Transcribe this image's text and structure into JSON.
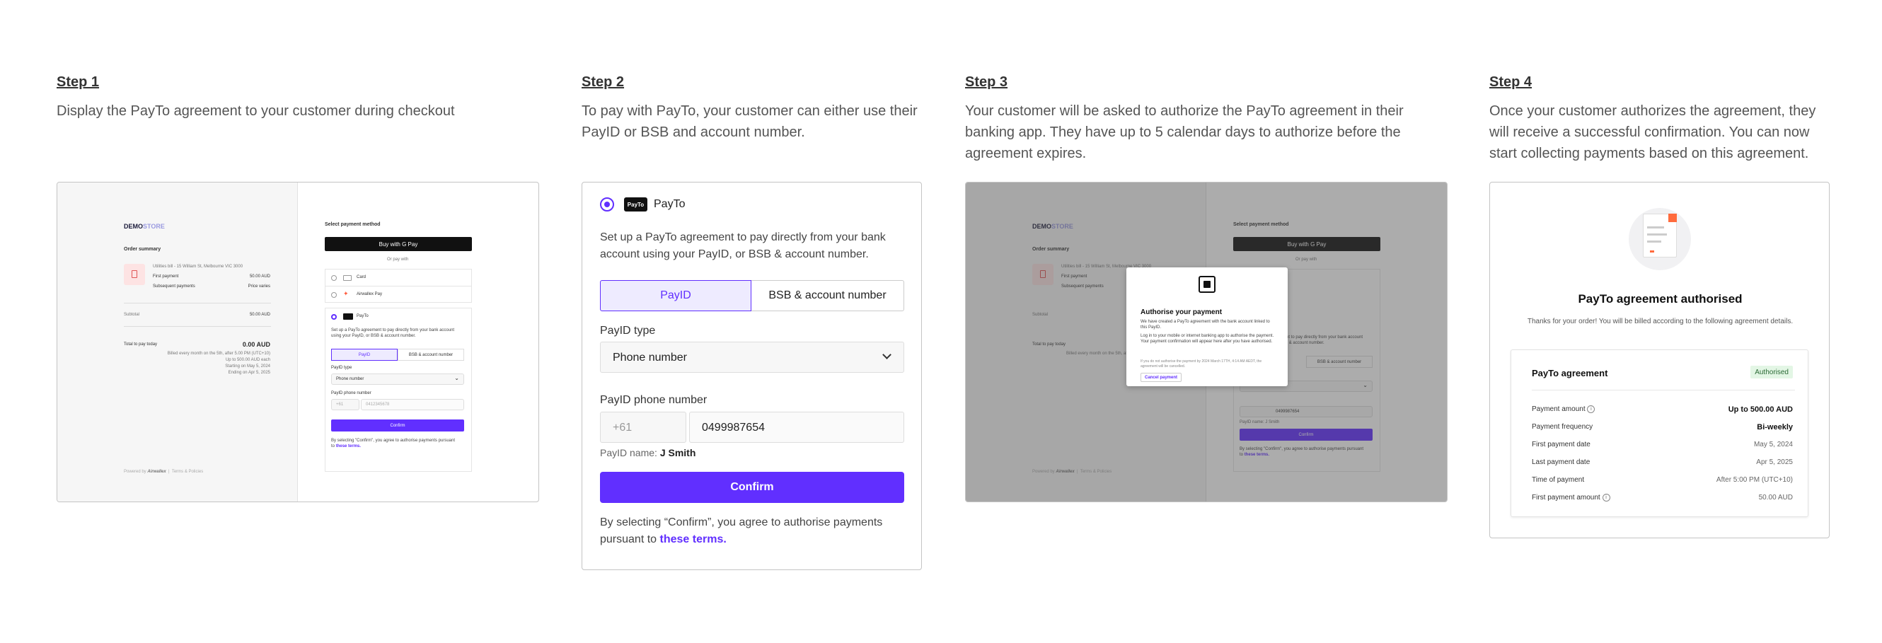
{
  "steps": [
    {
      "title": "Step 1",
      "desc": "Display the PayTo agreement to your customer during checkout"
    },
    {
      "title": "Step 2",
      "desc": "To pay with PayTo, your customer can either use their PayID or BSB and account number."
    },
    {
      "title": "Step 3",
      "desc": "Your customer will be asked to authorize the PayTo agreement in their banking app. They have up to 5 calendar days to authorize before the agreement expires."
    },
    {
      "title": "Step 4",
      "desc": "Once your customer authorizes the agreement, they will receive a successful confirmation. You can now start collecting payments based on this agreement."
    }
  ],
  "checkout": {
    "logo_demo": "DEMO",
    "logo_store": "STORE",
    "order_summary": "Order summary",
    "item_desc": "Utilities bill - 15 William St, Melbourne VIC 3000",
    "first_payment_label": "First payment",
    "first_payment_value": "50.00 AUD",
    "subsequent_label": "Subsequent payments",
    "subsequent_value": "Price varies",
    "subtotal_label": "Subtotal",
    "subtotal_value": "50.00 AUD",
    "total_label": "Total to pay today",
    "total_value": "0.00 AUD",
    "billing_line1": "Billed every month on the 5th, after 5.00 PM (UTC+10)",
    "billing_line2": "Up to 500.00 AUD each",
    "billing_line3": "Starting on May 5, 2024",
    "billing_line4": "Ending on Apr 5, 2025",
    "powered_by": "Powered by",
    "brand": "Airwallex",
    "footer_links": "Terms & Policies",
    "select_method": "Select payment method",
    "buy_with": "Buy with",
    "gpay": "G Pay",
    "or_pay_with": "Or pay with",
    "card": "Card",
    "airwallex_pay": "Airwallex Pay",
    "payto": "PayTo",
    "payto_desc": "Set up a PayTo agreement to pay directly from your bank account using your PayID, or BSB & account number.",
    "payid_tab": "PayID",
    "bsb_tab": "BSB & account number",
    "payid_type_label": "PayID type",
    "payid_type_value": "Phone number",
    "payid_phone_label": "PayID phone number",
    "country_code": "+61",
    "phone_placeholder": "0412345678",
    "confirm": "Confirm",
    "terms_prefix": "By selecting \"Confirm\", you agree to authorise payments pursuant to",
    "terms_link": "these terms."
  },
  "step2": {
    "payto_label": "PayTo",
    "payto_badge": "PayTo",
    "desc": "Set up a PayTo agreement to pay directly from your bank account using your PayID, or BSB & account number.",
    "tab_payid": "PayID",
    "tab_bsb": "BSB & account number",
    "payid_type_label": "PayID type",
    "payid_type_value": "Phone number",
    "phone_label": "PayID phone number",
    "country_code": "+61",
    "phone_value": "0499987654",
    "payid_name_label": "PayID name:",
    "payid_name_value": "J Smith",
    "confirm": "Confirm",
    "terms_prefix": "By selecting “Confirm”, you agree to authorise payments pursuant to",
    "terms_link": "these terms."
  },
  "step3": {
    "modal_title": "Authorise your payment",
    "modal_text1": "We have created a PayTo agreement with the bank account linked to this PayID.",
    "modal_text2": "Log in to your mobile or internet banking app to authorise the payment. Your payment confirmation will appear here after you have authorised.",
    "modal_note": "If you do not authorise the payment by 2024 March 17TH, 4:14 AM AEDT, the agreement will be cancelled.",
    "cancel": "Cancel payment",
    "phone_value": "0499987654",
    "payid_name": "PayID name: J Smith"
  },
  "step4": {
    "title": "PayTo agreement authorised",
    "subtitle": "Thanks for your order! You will be billed according to the following agreement details.",
    "card_title": "PayTo agreement",
    "badge": "Authorised",
    "rows": [
      {
        "label": "Payment amount",
        "value": "Up to 500.00 AUD"
      },
      {
        "label": "Payment frequency",
        "value": "Bi-weekly"
      },
      {
        "label": "First payment date",
        "value": "May 5, 2024"
      },
      {
        "label": "Last payment date",
        "value": "Apr 5, 2025"
      },
      {
        "label": "Time of payment",
        "value": "After 5:00 PM (UTC+10)"
      },
      {
        "label": "First payment amount",
        "value": "50.00 AUD"
      }
    ]
  },
  "colors": {
    "accent": "#612fff",
    "badge_bg": "#e3f6e5",
    "badge_fg": "#2b6a35",
    "overlay": "rgba(70,70,70,0.45)"
  }
}
